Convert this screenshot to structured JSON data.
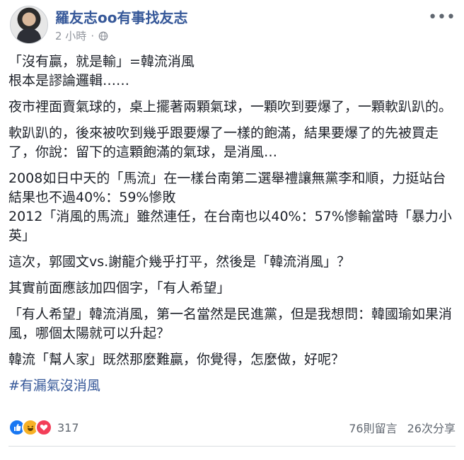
{
  "post": {
    "author": "羅友志oo有事找友志",
    "time": "2 小時",
    "paragraphs": [
      "「沒有贏，就是輸」=韓流消風\n根本是謬論邏輯……",
      "夜市裡面賣氣球的，桌上擺著兩顆氣球，一顆吹到要爆了，一顆軟趴趴的。",
      "軟趴趴的，後來被吹到幾乎跟要爆了一樣的飽滿，結果要爆了的先被買走了，你說：留下的這顆飽滿的氣球，是消風…",
      "2008如日中天的「馬流」在一樣台南第二選舉禮讓無黨李和順，力挺站台結果也不過40%：59%慘敗\n2012「消風的馬流」雖然連任，在台南也以40%：57%慘輸當時「暴力小英」",
      "這次，郭國文vs.謝龍介幾乎打平，然後是「韓流消風」？",
      "其實前面應該加四個字，「有人希望」",
      "「有人希望」韓流消風，第一名當然是民進黨，但是我想問：韓國瑜如果消風，哪個太陽就可以升起？",
      "韓流「幫人家」既然那麼難贏，你覺得，怎麼做，好呢？"
    ],
    "hashtag": "#有漏氣沒消風"
  },
  "footer": {
    "reaction_count": "317",
    "comments": "76則留言",
    "shares": "26次分享"
  },
  "colors": {
    "link": "#365899",
    "meta": "#90949c",
    "text": "#1d2129"
  }
}
